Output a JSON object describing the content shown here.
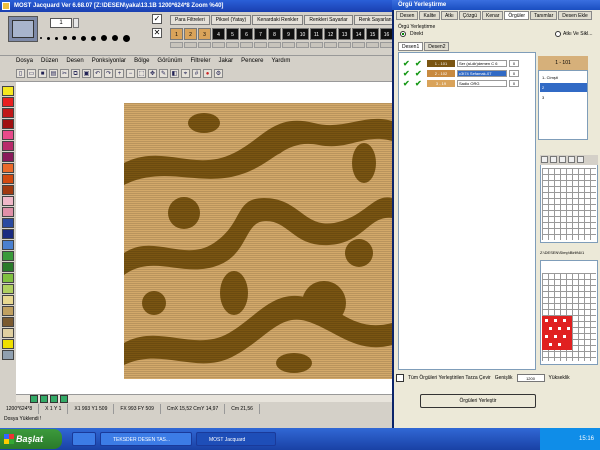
{
  "window": {
    "title": "MOST Jacquard   Ver 6.68.07   [Z:\\DESEN\\yaka\\13.1B  1200*624*8   Zoom %40]"
  },
  "toolbar": {
    "number_input": "1",
    "command_tabs": [
      "Para Filtreleri",
      "Piksel (Yatay)",
      "Kenardaki Renkler",
      "Renkleri Sayarlar",
      "Renk Sayarlan"
    ],
    "numbered_cells": [
      "1",
      "2",
      "3",
      "4",
      "5",
      "6",
      "7",
      "8",
      "9",
      "10",
      "11",
      "12",
      "13",
      "14",
      "15",
      "16",
      "17"
    ]
  },
  "menu": {
    "items": [
      "Dosya",
      "Düzen",
      "Desen",
      "Ponksiyonlar",
      "Bölge",
      "Görünüm",
      "Filtreler",
      "Jakar",
      "Pencere",
      "Yardım"
    ]
  },
  "palette": {
    "colors": [
      "#f6e820",
      "#e82020",
      "#c01818",
      "#a01010",
      "#e84a8a",
      "#b82a6a",
      "#8a1a5a",
      "#eb6a2a",
      "#d24a10",
      "#a03a10",
      "#f0b8c8",
      "#e090a8",
      "#2a4aa0",
      "#1a2a80",
      "#4a80d0",
      "#3a9a3a",
      "#2a7a2a",
      "#80c040",
      "#b0d060",
      "#e8d890",
      "#c0a060",
      "#7a5a30",
      "#e0d0a0",
      "#f0e000",
      "#90a0b0"
    ]
  },
  "design": {
    "background": "#d3a96a",
    "motif": "#7a5512"
  },
  "status": {
    "size": "1200*624*8",
    "pos": "X 1 Y 1",
    "x1": "X1 993 Y1 509",
    "fx": "FX 993 FY 509",
    "cmx": "CmX 15,52 CmY 14,97",
    "cm": "Cm 21,56",
    "line2": "Dosya Yüklendi !"
  },
  "panel": {
    "title": "Örgü Yerleştirme",
    "tabs": [
      "Desen",
      "Kalite",
      "Atkı",
      "Çözgü",
      "Kenar",
      "Örgüler",
      "Tanımlar",
      "Desen Ekle"
    ],
    "active_tab": "Örgüler",
    "group_label": "Örgü Yerleştirme",
    "radio_normal": "Direkt",
    "radio_alt": "Atkı Ve Sikl...",
    "sub_tabs": [
      "Desen1",
      "Desen2"
    ],
    "rows": [
      {
        "code": "1 - 101",
        "color": "#7a5512",
        "yarn": "Ser (al-dir)demen C 6",
        "count": "0"
      },
      {
        "code": "2 - 102",
        "color": "#c88a40",
        "yarn": "c3t74 Sefamak-07",
        "count": "0"
      },
      {
        "code": "3 - 19",
        "color": "#d9a35a",
        "yarn": "Sadio ORG",
        "count": "0"
      }
    ],
    "right_head": "1 - 101",
    "right_items": [
      "1- Cimşit",
      "2",
      "3"
    ],
    "file_label": "Z:\\DESEN\\Simp\\Birlit\\6\\1",
    "apply_all": "Tüm Örgüleri Yerleştirilen Tarza Çevir",
    "width_label": "Genişlik",
    "width_value": "1200",
    "height_label": "Yükseklik",
    "place_button": "Örgüleri Yerleştir"
  },
  "taskbar": {
    "start": "Başlat",
    "tasks": [
      "",
      "TEKSDER DESEN TAS...",
      "MOST Jacquard"
    ],
    "clock": "15:16"
  }
}
